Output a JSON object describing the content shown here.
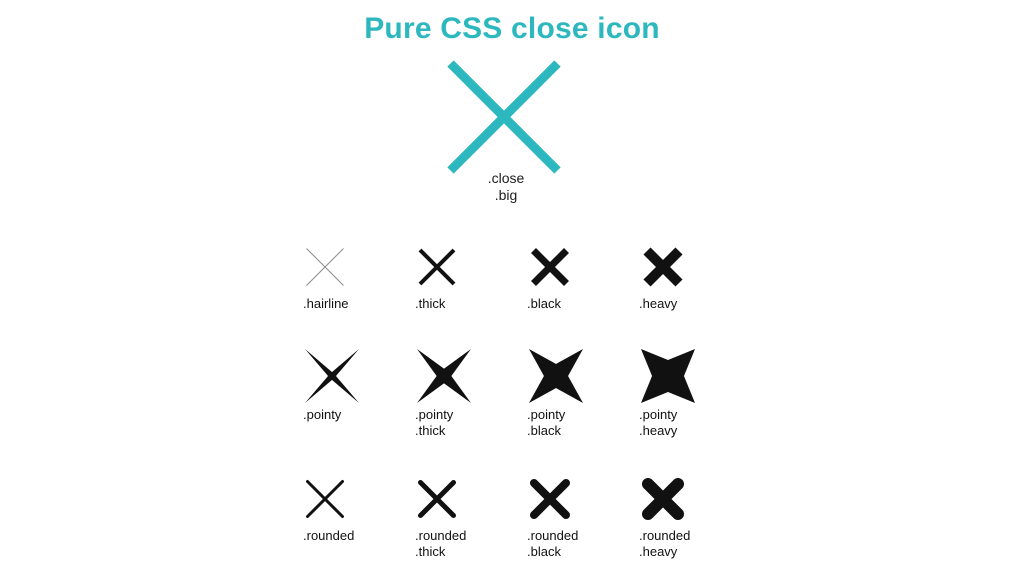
{
  "page": {
    "title": "Pure CSS close icon",
    "title_color": "#2db8c0",
    "background_color": "#ffffff"
  },
  "hero": {
    "icon_name": "close-icon-big",
    "color": "#2db8c0",
    "stroke_width": 9,
    "cap": "butt",
    "size": 120,
    "label_line1": ".close",
    "label_line2": ".big"
  },
  "grid": {
    "rows": [
      {
        "name": "flat",
        "cells": [
          {
            "icon_name": "close-icon-hairline",
            "label_line1": ".hairline",
            "label_line2": "",
            "color": "#8a8a8a",
            "stroke_width": 1,
            "cap": "butt",
            "size": 40,
            "shape": "stroke"
          },
          {
            "icon_name": "close-icon-thick",
            "label_line1": ".thick",
            "label_line2": "",
            "color": "#111111",
            "stroke_width": 4,
            "cap": "butt",
            "size": 40,
            "shape": "stroke"
          },
          {
            "icon_name": "close-icon-black",
            "label_line1": ".black",
            "label_line2": "",
            "color": "#111111",
            "stroke_width": 7,
            "cap": "butt",
            "size": 42,
            "shape": "stroke"
          },
          {
            "icon_name": "close-icon-heavy",
            "label_line1": ".heavy",
            "label_line2": "",
            "color": "#111111",
            "stroke_width": 10,
            "cap": "butt",
            "size": 44,
            "shape": "stroke"
          }
        ]
      },
      {
        "name": "pointy",
        "cells": [
          {
            "icon_name": "close-icon-pointy",
            "label_line1": ".pointy",
            "label_line2": "",
            "color": "#111111",
            "stroke_width": 3,
            "cap": "pointy",
            "size": 54,
            "shape": "taper"
          },
          {
            "icon_name": "close-icon-pointy-thick",
            "label_line1": ".pointy",
            "label_line2": ".thick",
            "color": "#111111",
            "stroke_width": 6,
            "cap": "pointy",
            "size": 54,
            "shape": "taper"
          },
          {
            "icon_name": "close-icon-pointy-black",
            "label_line1": ".pointy",
            "label_line2": ".black",
            "color": "#111111",
            "stroke_width": 11,
            "cap": "pointy",
            "size": 54,
            "shape": "taper"
          },
          {
            "icon_name": "close-icon-pointy-heavy",
            "label_line1": ".pointy",
            "label_line2": ".heavy",
            "color": "#111111",
            "stroke_width": 16,
            "cap": "pointy",
            "size": 54,
            "shape": "taper"
          }
        ]
      },
      {
        "name": "rounded",
        "cells": [
          {
            "icon_name": "close-icon-rounded",
            "label_line1": ".rounded",
            "label_line2": "",
            "color": "#111111",
            "stroke_width": 3,
            "cap": "round",
            "size": 40,
            "shape": "stroke"
          },
          {
            "icon_name": "close-icon-rounded-thick",
            "label_line1": ".rounded",
            "label_line2": ".thick",
            "color": "#111111",
            "stroke_width": 5,
            "cap": "round",
            "size": 40,
            "shape": "stroke"
          },
          {
            "icon_name": "close-icon-rounded-black",
            "label_line1": ".rounded",
            "label_line2": ".black",
            "color": "#111111",
            "stroke_width": 8,
            "cap": "round",
            "size": 42,
            "shape": "stroke"
          },
          {
            "icon_name": "close-icon-rounded-heavy",
            "label_line1": ".rounded",
            "label_line2": ".heavy",
            "color": "#111111",
            "stroke_width": 12,
            "cap": "round",
            "size": 44,
            "shape": "stroke"
          }
        ]
      }
    ]
  }
}
